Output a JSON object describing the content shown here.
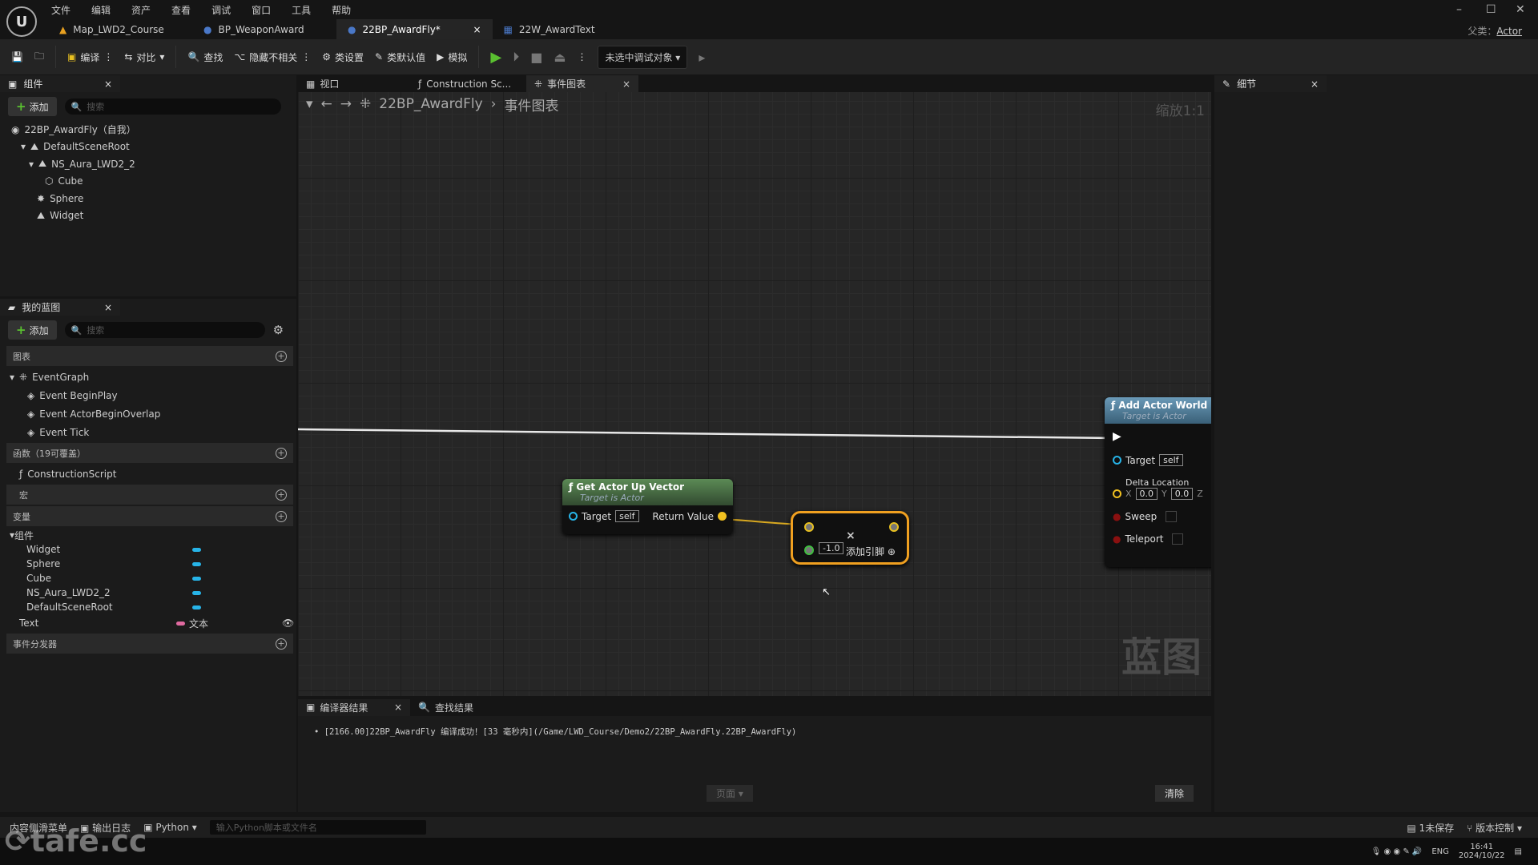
{
  "menu": [
    "文件",
    "编辑",
    "资产",
    "查看",
    "调试",
    "窗口",
    "工具",
    "帮助"
  ],
  "doc_tabs": [
    {
      "label": "Map_LWD2_Course",
      "icon": "map-icon"
    },
    {
      "label": "BP_WeaponAward",
      "icon": "blueprint-icon"
    },
    {
      "label": "22BP_AwardFly*",
      "icon": "blueprint-icon",
      "active": true
    },
    {
      "label": "22W_AwardText",
      "icon": "widget-icon"
    }
  ],
  "parent_label": "父类：",
  "parent_value": "Actor",
  "toolbar": {
    "compile": "编译",
    "diff": "对比",
    "find": "查找",
    "hide_unrelated": "隐藏不相关",
    "class_settings": "类设置",
    "class_defaults": "类默认值",
    "simulate": "模拟",
    "debug_target": "未选中调试对象"
  },
  "components": {
    "title": "组件",
    "add": "添加",
    "search_placeholder": "搜索",
    "tree": [
      "22BP_AwardFly（自我）",
      "DefaultSceneRoot",
      "NS_Aura_LWD2_2",
      "Cube",
      "Sphere",
      "Widget"
    ]
  },
  "my_blueprint": {
    "title": "我的蓝图",
    "add": "添加",
    "search_placeholder": "搜索",
    "graphs_header": "图表",
    "event_graph": "EventGraph",
    "events": [
      "Event BeginPlay",
      "Event ActorBeginOverlap",
      "Event Tick"
    ],
    "functions_header": "函数（19可覆盖）",
    "functions": [
      "ConstructionScript"
    ],
    "macros_header": "宏",
    "variables_header": "变量",
    "components_group": "组件",
    "component_vars": [
      "Widget",
      "Sphere",
      "Cube",
      "NS_Aura_LWD2_2",
      "DefaultSceneRoot"
    ],
    "text_var": "Text",
    "text_type": "文本",
    "dispatchers_header": "事件分发器"
  },
  "graph_tabs": [
    "视口",
    "Construction Sc...",
    "事件图表"
  ],
  "breadcrumb": [
    "22BP_AwardFly",
    "事件图表"
  ],
  "zoom": "缩放1:1",
  "watermark": "蓝图",
  "nodes": {
    "up_vector": {
      "title": "Get Actor Up Vector",
      "subtitle": "Target is Actor",
      "target": "Target",
      "self": "self",
      "ret": "Return Value"
    },
    "multiply": {
      "symbol": "×",
      "value": "-1.0",
      "add_pin": "添加引脚"
    },
    "offset": {
      "title": "Add Actor World Off",
      "subtitle": "Target is Actor",
      "target": "Target",
      "self": "self",
      "delta": "Delta Location",
      "x": "X",
      "xv": "0.0",
      "y": "Y",
      "yv": "0.0",
      "z": "Z",
      "sweep": "Sweep",
      "teleport": "Teleport"
    }
  },
  "colors": {
    "function_header": "#4e7a4a",
    "offset_header": "#4f7d98",
    "vector_pin": "#f0c020",
    "object_pin": "#27b4e8",
    "selection": "#f0a020"
  },
  "results": {
    "tab": "编译器结果",
    "find_tab": "查找结果",
    "log": "[2166.00]22BP_AwardFly 编译成功！[33 毫秒内](/Game/LWD_Course/Demo2/22BP_AwardFly.22BP_AwardFly)",
    "page": "页面",
    "clear": "清除"
  },
  "details": {
    "title": "细节"
  },
  "status": {
    "content_drawer": "内容侧滑菜单",
    "output_log": "输出日志",
    "python": "Python",
    "cmd_placeholder": "输入Python脚本或文件名",
    "unsaved": "1未保存",
    "source_control": "版本控制"
  },
  "taskbar": {
    "lang": "ENG",
    "time": "16:41",
    "date": "2024/10/22"
  },
  "watermark_logo": "tafe.cc"
}
